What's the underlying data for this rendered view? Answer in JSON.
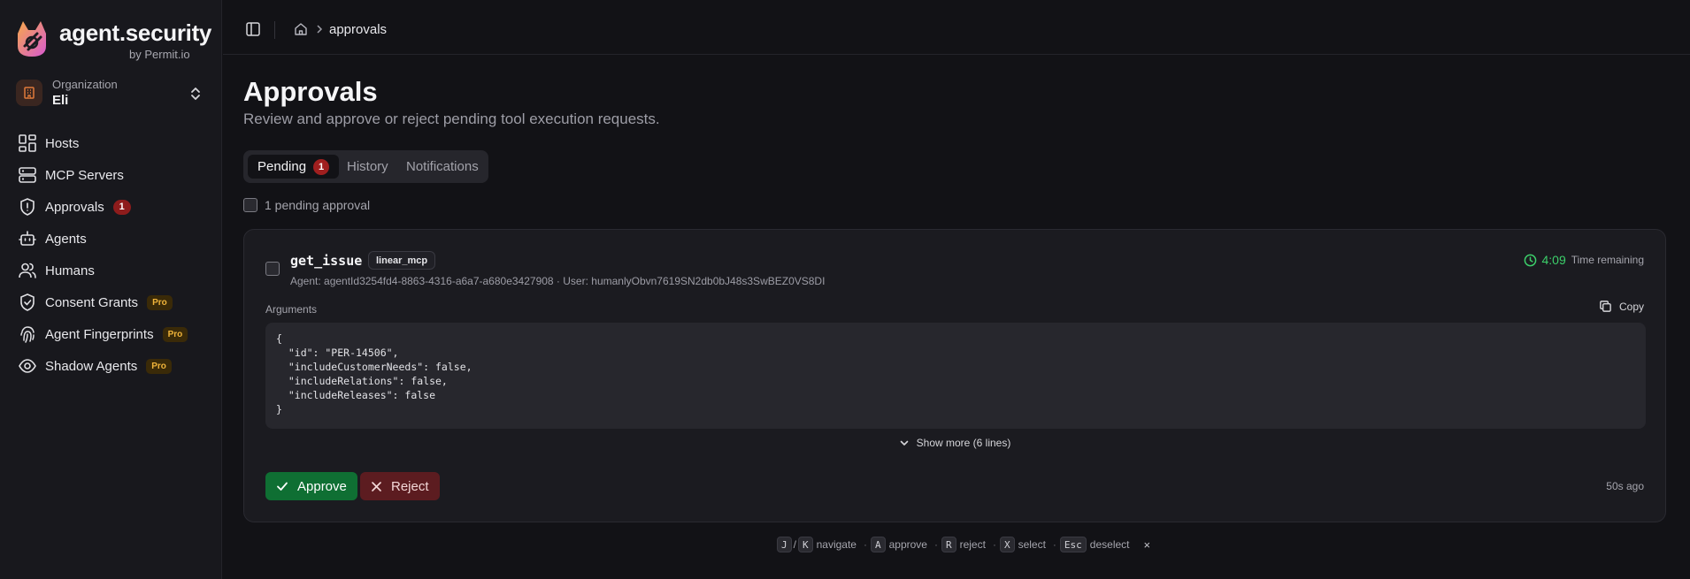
{
  "brand": {
    "name": "agent.security",
    "sub": "by Permit.io"
  },
  "org": {
    "label": "Organization",
    "name": "Eli"
  },
  "sidebar": {
    "items": [
      {
        "label": "Hosts",
        "icon": "grid-icon"
      },
      {
        "label": "MCP Servers",
        "icon": "server-icon"
      },
      {
        "label": "Approvals",
        "icon": "shield-alert-icon",
        "badge": "1"
      },
      {
        "label": "Agents",
        "icon": "bot-icon"
      },
      {
        "label": "Humans",
        "icon": "users-icon"
      },
      {
        "label": "Consent Grants",
        "icon": "shield-check-icon",
        "pro": "Pro"
      },
      {
        "label": "Agent Fingerprints",
        "icon": "fingerprint-icon",
        "pro": "Pro"
      },
      {
        "label": "Shadow Agents",
        "icon": "eye-icon",
        "pro": "Pro"
      }
    ]
  },
  "topbar": {
    "crumb": "approvals"
  },
  "page": {
    "title": "Approvals",
    "subtitle": "Review and approve or reject pending tool execution requests."
  },
  "tabs": [
    {
      "label": "Pending",
      "badge": "1",
      "active": true
    },
    {
      "label": "History"
    },
    {
      "label": "Notifications"
    }
  ],
  "bulk": {
    "label": "1 pending approval"
  },
  "request": {
    "tool": "get_issue",
    "server": "linear_mcp",
    "meta": "Agent: agentId3254fd4-8863-4316-a6a7-a680e3427908 · User: humanlyObvn7619SN2db0bJ48s3SwBEZ0VS8DI",
    "timer_value": "4:09",
    "timer_label": "Time remaining",
    "args_label": "Arguments",
    "copy_label": "Copy",
    "code": "{\n  \"id\": \"PER-14506\",\n  \"includeCustomerNeeds\": false,\n  \"includeRelations\": false,\n  \"includeReleases\": false\n}",
    "show_more": "Show more (6 lines)",
    "approve": "Approve",
    "reject": "Reject",
    "ago": "50s ago"
  },
  "shortcuts": {
    "k1": "J",
    "slash": "/",
    "k2": "K",
    "t1": "navigate",
    "k3": "A",
    "t2": "approve",
    "k4": "R",
    "t3": "reject",
    "k5": "X",
    "t4": "select",
    "k6": "Esc",
    "t5": "deselect",
    "close": "×"
  },
  "colors": {
    "accent_green": "#0f6f33",
    "danger": "#8e1c1c",
    "timer": "#3ccf6a",
    "pro": "#f0b43a"
  }
}
